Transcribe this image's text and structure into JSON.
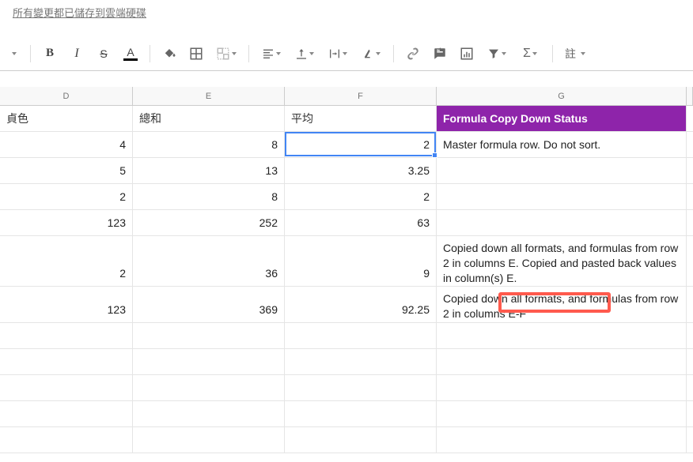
{
  "save_status": "所有變更都已儲存到雲端硬碟",
  "toolbar": {
    "comment_label": "註"
  },
  "columns": {
    "d": "D",
    "e": "E",
    "f": "F",
    "g": "G"
  },
  "headers": {
    "d_partial": "貞色",
    "e": "總和",
    "f": "平均",
    "g": "Formula Copy Down Status"
  },
  "rows": [
    {
      "d": "4",
      "e": "8",
      "f": "2",
      "g": "Master formula row. Do not sort."
    },
    {
      "d": "5",
      "e": "13",
      "f": "3.25",
      "g": ""
    },
    {
      "d": "2",
      "e": "8",
      "f": "2",
      "g": ""
    },
    {
      "d": "123",
      "e": "252",
      "f": "63",
      "g": ""
    },
    {
      "d": "2",
      "e": "36",
      "f": "9",
      "g": "Copied down all formats, and formulas from row 2 in columns E. Copied and pasted back values in column(s) E."
    },
    {
      "d": "123",
      "e": "369",
      "f": "92.25",
      "g": "Copied down all formats, and formulas from row 2 in columns E-F"
    }
  ],
  "annotation_fragment": "in columns E-F",
  "chart_data": {
    "type": "table",
    "columns": [
      "D",
      "E (總和)",
      "F (平均)",
      "G (Formula Copy Down Status)"
    ],
    "rows": [
      [
        4,
        8,
        2,
        "Master formula row. Do not sort."
      ],
      [
        5,
        13,
        3.25,
        ""
      ],
      [
        2,
        8,
        2,
        ""
      ],
      [
        123,
        252,
        63,
        ""
      ],
      [
        2,
        36,
        9,
        "Copied down all formats, and formulas from row 2 in columns E. Copied and pasted back values in column(s) E."
      ],
      [
        123,
        369,
        92.25,
        "Copied down all formats, and formulas from row 2 in columns E-F"
      ]
    ]
  }
}
